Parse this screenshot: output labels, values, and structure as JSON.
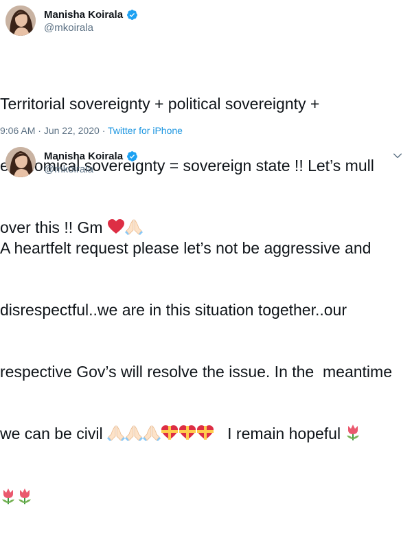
{
  "tweets": [
    {
      "display_name": "Manisha Koirala",
      "handle": "@mkoirala",
      "text_line1": "Territorial sovereignty + political sovereignty +",
      "text_line2": "economical sovereignty = sovereign state !! Let’s mull",
      "text_line3": "over this !! Gm",
      "time": "9:06 AM",
      "separator": "·",
      "date": "Jun 22, 2020",
      "source": "Twitter for iPhone"
    },
    {
      "display_name": "Manisha Koirala",
      "handle": "@mkoirala",
      "text_line1": "A heartfelt request please let’s not be aggressive and",
      "text_line2": "disrespectful..we are in this situation together..our",
      "text_line3": "respective Gov’s will resolve the issue. In the  meantime",
      "text_line4a": "we can be civil",
      "text_line4b": "I remain hopeful"
    }
  ],
  "colors": {
    "verified": "#1da1f2",
    "heart": "#e0245e",
    "source_link": "#1b95e0",
    "secondary_text": "#5b7083"
  },
  "icons": [
    "verified-badge-icon",
    "chevron-down-icon",
    "red-heart-emoji",
    "folded-hands-emoji",
    "gift-heart-emoji",
    "tulip-emoji"
  ]
}
